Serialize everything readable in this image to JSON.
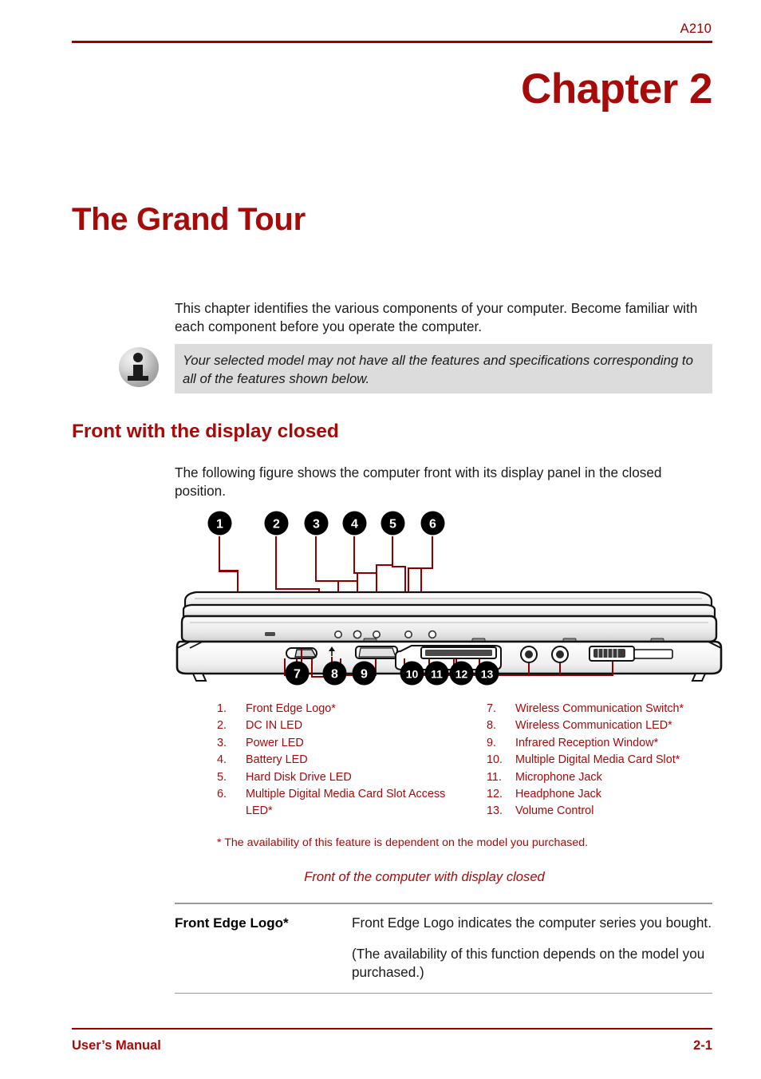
{
  "header": {
    "model_label": "A210"
  },
  "chapter": {
    "title": "Chapter 2",
    "heading": "The Grand Tour"
  },
  "intro": {
    "paragraph": "This chapter identifies the various components of your computer. Become familiar with each component before you operate the computer."
  },
  "note": {
    "icon": "info-icon",
    "text": "Your selected model may not have all the features and specifications corresponding to all of the features shown below."
  },
  "section": {
    "heading": "Front with the display closed",
    "paragraph": "The following figure shows the computer front with its display panel in the closed position."
  },
  "figure": {
    "caption": "Front of the computer with display closed",
    "footnote": "* The availability of this feature is dependent on the model you purchased.",
    "callouts": [
      "1",
      "2",
      "3",
      "4",
      "5",
      "6",
      "7",
      "8",
      "9",
      "10",
      "11",
      "12",
      "13"
    ],
    "legend_left": [
      {
        "num": "1.",
        "label": "Front Edge Logo*"
      },
      {
        "num": "2.",
        "label": "DC IN LED"
      },
      {
        "num": "3.",
        "label": "Power LED"
      },
      {
        "num": "4.",
        "label": "Battery LED"
      },
      {
        "num": "5.",
        "label": "Hard Disk Drive LED"
      },
      {
        "num": "6.",
        "label": "Multiple Digital Media Card Slot Access LED*"
      }
    ],
    "legend_right": [
      {
        "num": "7.",
        "label": "Wireless Communication Switch*"
      },
      {
        "num": "8.",
        "label": "Wireless Communication LED*"
      },
      {
        "num": "9.",
        "label": "Infrared Reception Window*"
      },
      {
        "num": "10.",
        "label": "Multiple Digital Media Card Slot*"
      },
      {
        "num": "11.",
        "label": "Microphone Jack"
      },
      {
        "num": "12.",
        "label": "Headphone Jack"
      },
      {
        "num": "13.",
        "label": "Volume Control"
      }
    ]
  },
  "definition": {
    "term": "Front Edge Logo*",
    "desc1": "Front Edge Logo indicates the computer series you bought.",
    "desc2": "(The availability of this function depends on the model you purchased.)"
  },
  "footer": {
    "left": "User’s Manual",
    "right": "2-1"
  },
  "colors": {
    "brand_red": "#A80A0A",
    "rule_red": "#990000",
    "note_bg": "#dcdcdc",
    "table_rule": "#999999"
  }
}
